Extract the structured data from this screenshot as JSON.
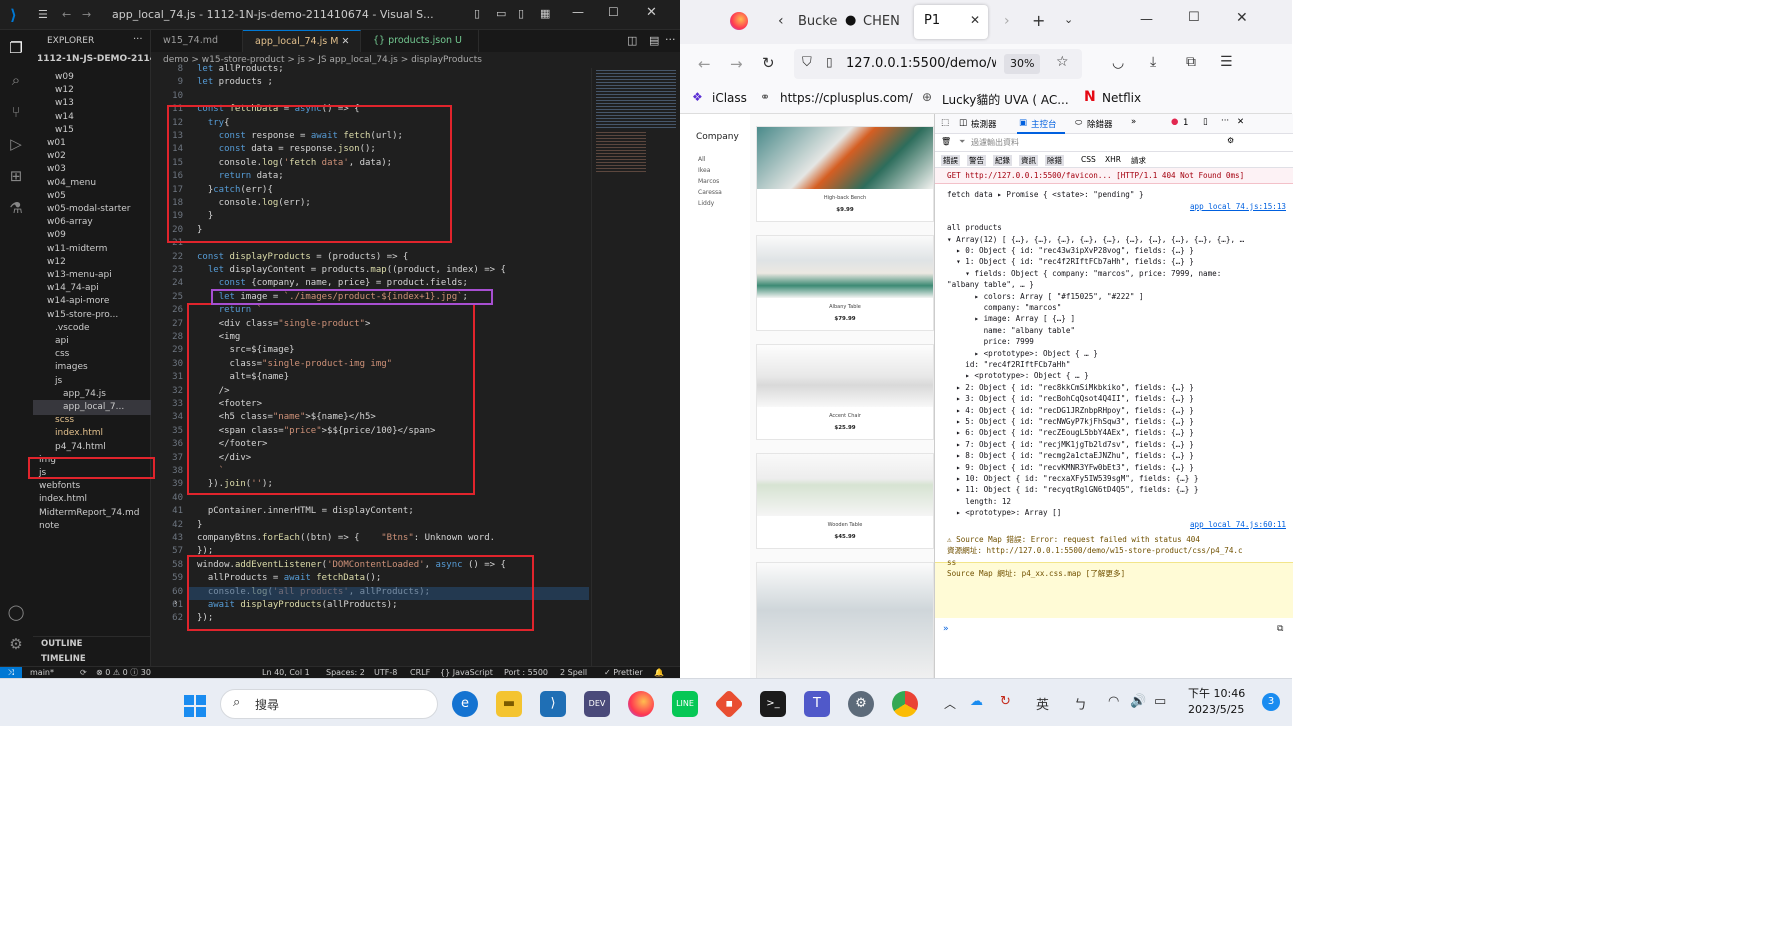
{
  "vscode": {
    "title": "app_local_74.js - 1112-1N-js-demo-211410674 - Visual S...",
    "explorer_label": "EXPLORER",
    "project": "1112-1N-JS-DEMO-211410...",
    "tree": [
      "w09",
      "w12",
      "w13",
      "w14",
      "w15",
      "w01",
      "w02",
      "w03",
      "w04_menu",
      "w05",
      "w05-modal-starter",
      "w06-array",
      "w09",
      "w11-midterm",
      "w12",
      "w13-menu-api",
      "w14_74-api",
      "w14-api-more",
      "w15-store-pro...",
      ".vscode",
      "api",
      "css",
      "images",
      "js",
      "app_74.js",
      "app_local_7...",
      "scss",
      "index.html",
      "p4_74.html",
      "img",
      "js",
      "webfonts",
      "index.html",
      "MidtermReport_74.md",
      "note"
    ],
    "outline": "OUTLINE",
    "timeline": "TIMELINE",
    "tabs": [
      "w15_74.md",
      "app_local_74.js M",
      "{} products.json U"
    ],
    "breadcrumb": "demo > w15-store-product > js > JS app_local_74.js > displayProducts",
    "lines": [
      "8",
      "9",
      "10",
      "11",
      "12",
      "13",
      "14",
      "15",
      "16",
      "17",
      "18",
      "19",
      "20",
      "21",
      "22",
      "23",
      "24",
      "25",
      "26",
      "27",
      "28",
      "29",
      "30",
      "31",
      "32",
      "33",
      "34",
      "35",
      "36",
      "37",
      "38",
      "39",
      "40",
      "41",
      "42",
      "43",
      "57",
      "58",
      "59",
      "60",
      "61",
      "62"
    ],
    "code": [
      "let allProducts;",
      "let products ;",
      "",
      "const fetchData = async() => {",
      "  try{",
      "    const response = await fetch(url);",
      "    const data = response.json();",
      "    console.log('fetch data', data);",
      "    return data;",
      "  }catch(err){",
      "    console.log(err);",
      "  }",
      "}",
      "",
      "const displayProducts = (products) => {",
      "  let displayContent = products.map((product, index) => {",
      "    const {company, name, price} = product.fields;",
      "    let image = `./images/product-${index+1}.jpg`;",
      "    return `",
      "    <div class=\"single-product\">",
      "    <img",
      "      src=${image}",
      "      class=\"single-product-img img\"",
      "      alt=${name}",
      "    />",
      "    <footer>",
      "    <h5 class=\"name\">${name}</h5>",
      "    <span class=\"price\">$${price/100}</span>",
      "    </footer>",
      "    </div>",
      "    `",
      "  }).join('');",
      "",
      "  pContainer.innerHTML = displayContent;",
      "}",
      "companyBtns.forEach((btn) => {    \"Btns\": Unknown word.",
      "});",
      "window.addEventListener('DOMContentLoaded', async () => {",
      "  allProducts = await fetchData();",
      "  console.log('all products', allProducts);",
      "  await displayProducts(allProducts);",
      "});"
    ],
    "status": {
      "branch": "main*",
      "problems": "⊗ 0 ⚠ 0 ⓘ 30",
      "position": "Ln 40, Col 1",
      "spaces": "Spaces: 2",
      "encoding": "UTF-8",
      "eol": "CRLF",
      "language": "{} JavaScript",
      "port": "Port : 5500",
      "spell": "2 Spell",
      "prettier": "✓ Prettier"
    }
  },
  "firefox": {
    "tabs": [
      "Bucke",
      "CHEN",
      "P1"
    ],
    "url": "127.0.0.1:5500/demo/w1",
    "zoom": "30%",
    "bookmarks": [
      "iClass",
      "https://cplusplus.com/",
      "Lucky貓的 UVA ( AC...",
      "Netflix"
    ],
    "page": {
      "company_title": "Company",
      "filters": [
        "All",
        "Ikea",
        "Marcos",
        "Caressa",
        "Liddy"
      ],
      "products": [
        {
          "name": "High-back Bench",
          "price": "$9.99"
        },
        {
          "name": "Albany Table",
          "price": "$79.99"
        },
        {
          "name": "Accent Chair",
          "price": "$25.99"
        },
        {
          "name": "Wooden Table",
          "price": "$45.99"
        }
      ]
    },
    "devtools": {
      "tabs": [
        "檢測器",
        "主控台",
        "除錯器"
      ],
      "error_count": "1",
      "filter_placeholder": "過濾輸出資料",
      "levels": [
        "錯誤",
        "警告",
        "紀錄",
        "資訊",
        "除錯"
      ],
      "types": [
        "CSS",
        "XHR",
        "請求"
      ],
      "console": [
        "GET http://127.0.0.1:5500/favicon... [HTTP/1.1 404 Not Found 0ms]",
        "fetch data ▸ Promise { <state>: \"pending\" }",
        "app_local_74.js:15:13",
        "all products",
        "▾ Array(12) [ {…}, {…}, {…}, {…}, {…}, {…}, {…}, {…}, {…}, {…}, …",
        "  ▸ 0: Object { id: \"rec43w3ipXvP28vog\", fields: {…} }",
        "  ▾ 1: Object { id: \"rec4f2RIftFCb7aHh\", fields: {…} }",
        "    ▾ fields: Object { company: \"marcos\", price: 7999, name:",
        "\"albany table\", … }",
        "      ▸ colors: Array [ \"#f15025\", \"#222\" ]",
        "        company: \"marcos\"",
        "      ▸ image: Array [ {…} ]",
        "        name: \"albany table\"",
        "        price: 7999",
        "      ▸ <prototype>: Object { … }",
        "    id: \"rec4f2RIftFCb7aHh\"",
        "    ▸ <prototype>: Object { … }",
        "  ▸ 2: Object { id: \"rec8kkCmSiMkbkiko\", fields: {…} }",
        "  ▸ 3: Object { id: \"recBohCqQsot4Q4II\", fields: {…} }",
        "  ▸ 4: Object { id: \"recDG1JRZnbpRHpoy\", fields: {…} }",
        "  ▸ 5: Object { id: \"recNWGyP7kjFhSqw3\", fields: {…} }",
        "  ▸ 6: Object { id: \"recZEougL5bbY4AEx\", fields: {…} }",
        "  ▸ 7: Object { id: \"recjMK1jgTb2ld7sv\", fields: {…} }",
        "  ▸ 8: Object { id: \"recmg2a1ctaEJNZhu\", fields: {…} }",
        "  ▸ 9: Object { id: \"recvKMNR3YFw0bEt3\", fields: {…} }",
        "  ▸ 10: Object { id: \"recxaXFy5IW539sgM\", fields: {…} }",
        "  ▸ 11: Object { id: \"recyqtRglGN6tD4Q5\", fields: {…} }",
        "    length: 12",
        "  ▸ <prototype>: Array []",
        "app_local_74.js:60:11",
        "⚠ Source Map 錯誤: Error: request failed with status 404",
        "資源網址: http://127.0.0.1:5500/demo/w15-store-product/css/p4_74.c",
        "ss",
        "Source Map 網址: p4_xx.css.map [了解更多]"
      ]
    }
  },
  "taskbar": {
    "search": "搜尋",
    "ime": "英",
    "time": "下午 10:46",
    "date": "2023/5/25",
    "notifications": "3"
  }
}
